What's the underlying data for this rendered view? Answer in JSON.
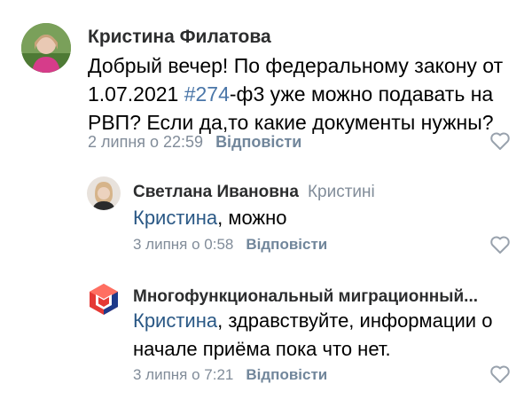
{
  "comments": [
    {
      "author": "Кристина Филатова",
      "text_parts": [
        "Добрый вечер! По федеральному закону от 1.07.2021 ",
        "#274",
        "-ф3 уже можно подавать на РВП? Если да,то какие документы нужны?"
      ],
      "date": "2 липня о 22:59",
      "reply_label": "Відповісти",
      "avatar_icon": "user-photo-avatar"
    },
    {
      "author": "Светлана Ивановна",
      "reply_to": "Кристині",
      "mention": "Кристина",
      "text": ", можно",
      "date": "3 липня о 0:58",
      "reply_label": "Відповісти",
      "avatar_icon": "user-photo-avatar"
    },
    {
      "author": "Многофункциональный миграционный...",
      "mention": "Кристина",
      "text": ", здравствуйте, информации о начале приёма пока что нет.",
      "date": "3 липня о 7:21",
      "reply_label": "Відповісти",
      "avatar_icon": "community-logo-avatar"
    }
  ],
  "colors": {
    "link": "#2a5885",
    "hashtag": "#4a76a8",
    "meta": "#818c99",
    "reply": "#71869b"
  },
  "icons": {
    "like": "heart-outline-icon"
  }
}
